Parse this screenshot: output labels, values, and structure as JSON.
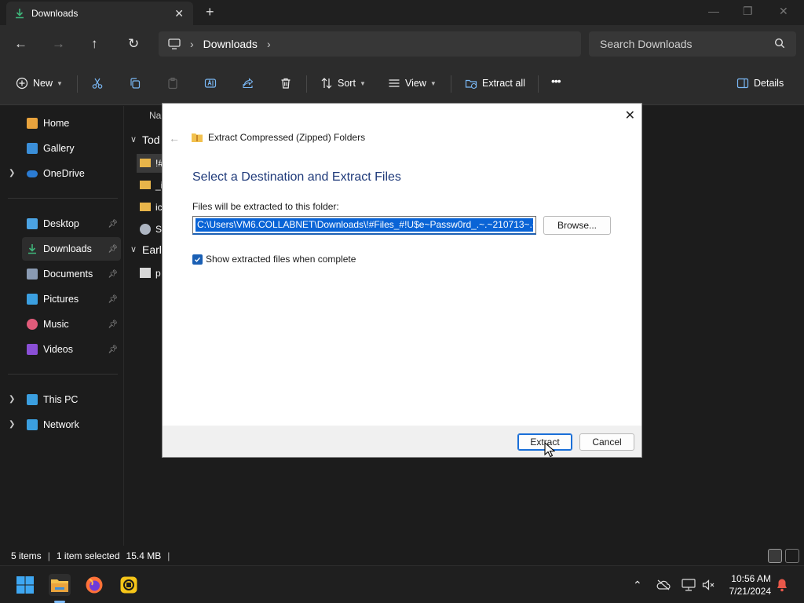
{
  "window": {
    "tab_title": "Downloads",
    "tab_close": "✕",
    "new_tab": "+",
    "controls": {
      "minimize": "—",
      "maximize": "❐",
      "close": "✕"
    }
  },
  "nav": {
    "back": "←",
    "forward": "→",
    "up": "↑",
    "refresh": "↻",
    "breadcrumb_sep": "›",
    "breadcrumb_current": "Downloads",
    "search_placeholder": "Search Downloads"
  },
  "toolbar": {
    "new_label": "New",
    "sort_label": "Sort",
    "view_label": "View",
    "extract_all_label": "Extract all",
    "more_label": "•••",
    "details_label": "Details"
  },
  "sidebar": {
    "items": [
      {
        "label": "Home",
        "icon": "home-icon",
        "color": "#e8a33d"
      },
      {
        "label": "Gallery",
        "icon": "gallery-icon",
        "color": "#3b8fd9"
      },
      {
        "label": "OneDrive",
        "icon": "cloud-icon",
        "color": "#2b7cd3"
      },
      {
        "label": "Desktop",
        "icon": "desktop-icon",
        "color": "#4ba3e3"
      },
      {
        "label": "Downloads",
        "icon": "download-icon",
        "color": "#3fb57a"
      },
      {
        "label": "Documents",
        "icon": "documents-icon",
        "color": "#8a9bb3"
      },
      {
        "label": "Pictures",
        "icon": "pictures-icon",
        "color": "#3b9fe0"
      },
      {
        "label": "Music",
        "icon": "music-icon",
        "color": "#e05b7a"
      },
      {
        "label": "Videos",
        "icon": "videos-icon",
        "color": "#8a4fd6"
      },
      {
        "label": "This PC",
        "icon": "pc-icon",
        "color": "#3b9fe0"
      },
      {
        "label": "Network",
        "icon": "network-icon",
        "color": "#3b9fe0"
      }
    ]
  },
  "filelist": {
    "header_name": "Na",
    "group_today": "Tod",
    "group_earlier": "Earl",
    "rows": [
      "!#",
      "_i",
      "ic",
      "St",
      "p"
    ]
  },
  "status": {
    "items": "5 items",
    "selected": "1 item selected",
    "size": "15.4 MB",
    "sep": "|"
  },
  "dialog": {
    "caption": "Extract Compressed (Zipped) Folders",
    "heading": "Select a Destination and Extract Files",
    "dest_label": "Files will be extracted to this folder:",
    "dest_path": "C:\\Users\\VM6.COLLABNET\\Downloads\\!#Files_#!U$e~Passw0rd_.~.~210713~.~_",
    "browse_label": "Browse...",
    "show_files_label": "Show extracted files when complete",
    "show_files_checked": true,
    "extract_label": "Extract",
    "cancel_label": "Cancel",
    "close": "✕",
    "back": "←"
  },
  "taskbar": {
    "time": "10:56 AM",
    "date": "7/21/2024",
    "tray_chevron": "⌃"
  },
  "colors": {
    "accent": "#1a5fb4",
    "selection": "#0a64d6",
    "dialog_heading": "#1f3a7a"
  }
}
